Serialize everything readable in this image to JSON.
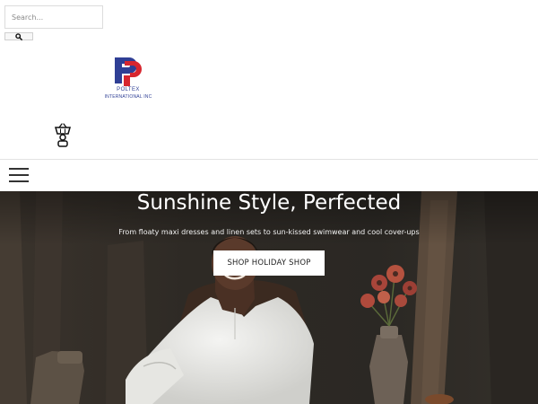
{
  "search": {
    "placeholder": "Search..."
  },
  "brand": {
    "name": "POLTEX",
    "subtitle": "INTERNATIONAL INC",
    "colors": {
      "blue": "#2f3f95",
      "red": "#d7262f"
    }
  },
  "header": {
    "cart_icon": "shopping-basket-icon",
    "menu_icon": "hamburger-menu-icon"
  },
  "hero": {
    "title": "Sunshine Style, Perfected",
    "subtitle": "From floaty maxi dresses and linen sets to sun-kissed swimwear and cool cover-ups",
    "cta_label": "SHOP HOLIDAY SHOP"
  }
}
